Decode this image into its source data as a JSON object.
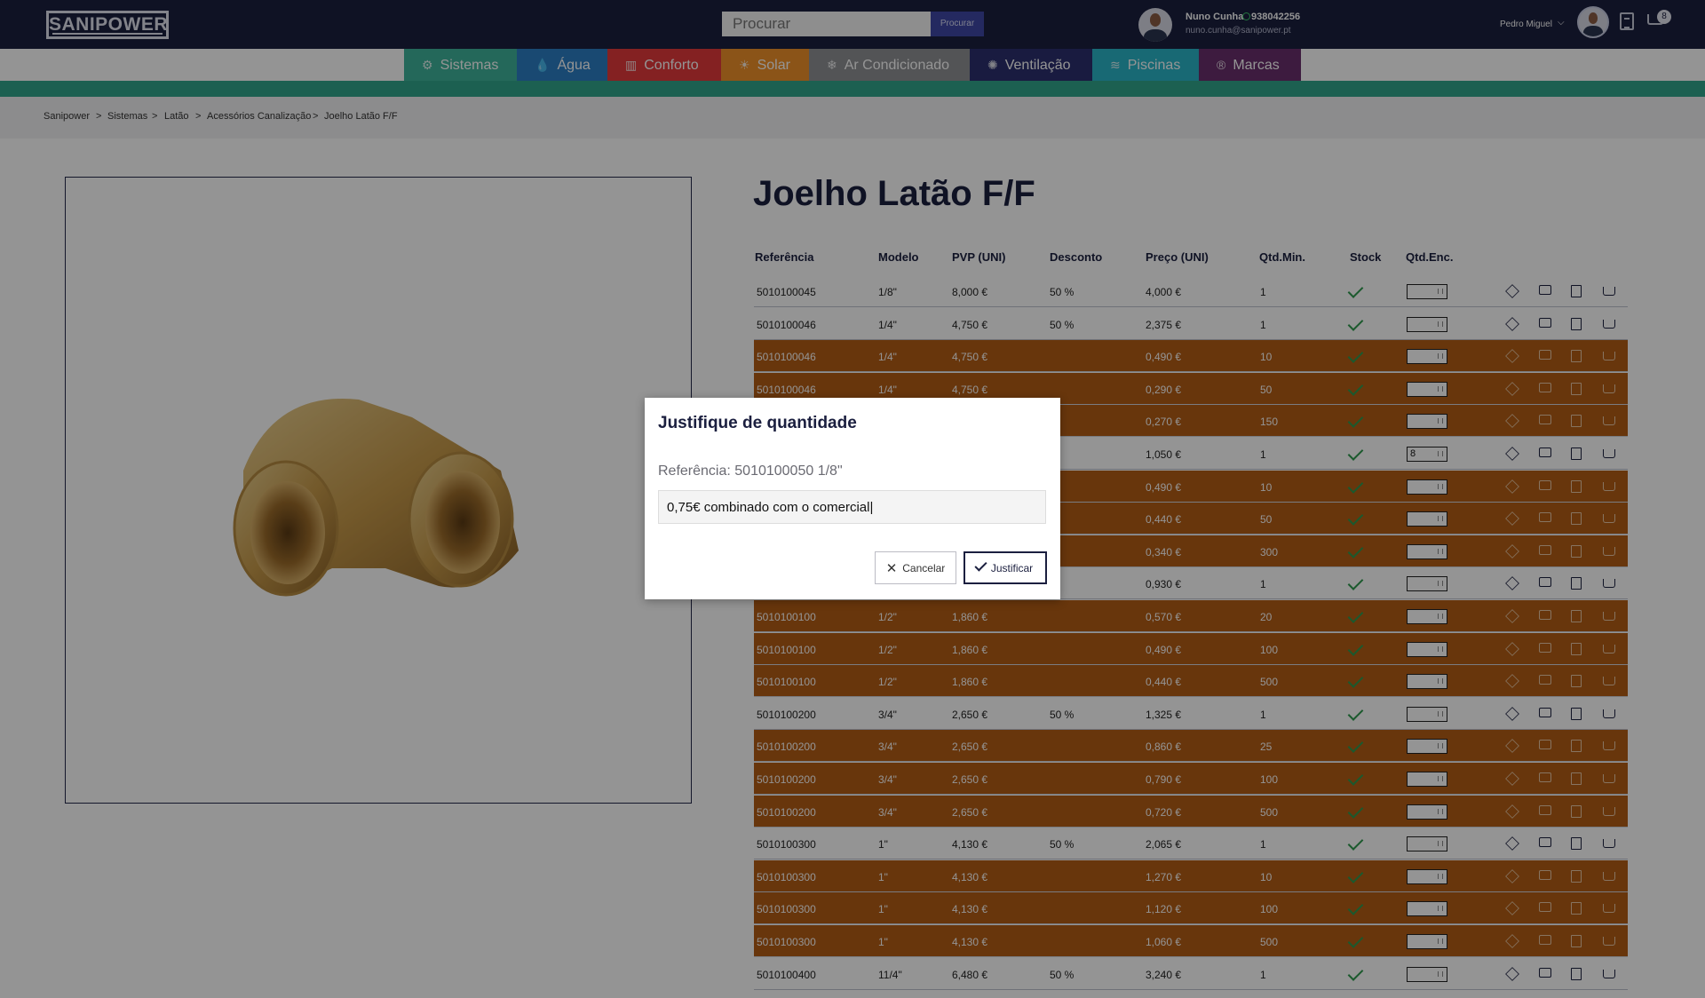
{
  "header": {
    "logo": "SANIPOWER",
    "search_placeholder": "Procurar",
    "search_button": "Procurar",
    "contact_name": "Nuno Cunha",
    "contact_phone": "938042256",
    "contact_email": "nuno.cunha@sanipower.pt",
    "user_name": "Pedro Miguel",
    "cart_count": "8"
  },
  "nav": [
    {
      "label": "Sistemas",
      "color": "#3fb39c",
      "icon": "gear-icon"
    },
    {
      "label": "Água",
      "color": "#2c7fc4",
      "icon": "water-drops-icon"
    },
    {
      "label": "Conforto",
      "color": "#e43a3b",
      "icon": "radiator-icon"
    },
    {
      "label": "Solar",
      "color": "#f0922a",
      "icon": "sun-icon"
    },
    {
      "label": "Ar Condicionado",
      "color": "#8f9195",
      "icon": "ac-unit-icon"
    },
    {
      "label": "Ventilação",
      "color": "#2b2f6e",
      "icon": "fan-icon"
    },
    {
      "label": "Piscinas",
      "color": "#2ab6c8",
      "icon": "pool-icon"
    },
    {
      "label": "Marcas",
      "color": "#6a2f6d",
      "icon": "registered-icon"
    }
  ],
  "breadcrumb": [
    "Sanipower",
    "Sistemas",
    "Latão",
    "Acessórios Canalização",
    "Joelho Latão F/F"
  ],
  "product": {
    "title": "Joelho Latão F/F",
    "image": "brass-elbow-fitting-image"
  },
  "table": {
    "headers": [
      "Referência",
      "Modelo",
      "PVP (UNI)",
      "Desconto",
      "Preço (UNI)",
      "Qtd.Min.",
      "Stock",
      "Qtd.Enc."
    ],
    "rows": [
      {
        "ref": "5010100045",
        "model": "1/8\"",
        "pvp": "8,000 €",
        "disc": "50 %",
        "price": "4,000 €",
        "min": "1",
        "qty": "",
        "highlight": false
      },
      {
        "ref": "5010100046",
        "model": "1/4\"",
        "pvp": "4,750 €",
        "disc": "50 %",
        "price": "2,375 €",
        "min": "1",
        "qty": "",
        "highlight": false
      },
      {
        "ref": "5010100046",
        "model": "1/4\"",
        "pvp": "4,750 €",
        "disc": "",
        "price": "0,490 €",
        "min": "10",
        "qty": "",
        "highlight": true
      },
      {
        "ref": "5010100046",
        "model": "1/4\"",
        "pvp": "4,750 €",
        "disc": "",
        "price": "0,290 €",
        "min": "50",
        "qty": "",
        "highlight": true
      },
      {
        "ref": "",
        "model": "",
        "pvp": "",
        "disc": "",
        "price": "0,270 €",
        "min": "150",
        "qty": "",
        "highlight": true
      },
      {
        "ref": "",
        "model": "",
        "pvp": "",
        "disc": "% ",
        "price": "1,050 €",
        "min": "1",
        "qty": "8",
        "highlight": false
      },
      {
        "ref": "",
        "model": "",
        "pvp": "",
        "disc": "",
        "price": "0,490 €",
        "min": "10",
        "qty": "",
        "highlight": true
      },
      {
        "ref": "",
        "model": "",
        "pvp": "",
        "disc": "",
        "price": "0,440 €",
        "min": "50",
        "qty": "",
        "highlight": true
      },
      {
        "ref": "",
        "model": "",
        "pvp": "",
        "disc": "",
        "price": "0,340 €",
        "min": "300",
        "qty": "",
        "highlight": true
      },
      {
        "ref": "",
        "model": "",
        "pvp": "",
        "disc": "% ",
        "price": "0,930 €",
        "min": "1",
        "qty": "",
        "highlight": false
      },
      {
        "ref": "5010100100",
        "model": "1/2\"",
        "pvp": "1,860 €",
        "disc": "",
        "price": "0,570 €",
        "min": "20",
        "qty": "",
        "highlight": true
      },
      {
        "ref": "5010100100",
        "model": "1/2\"",
        "pvp": "1,860 €",
        "disc": "",
        "price": "0,490 €",
        "min": "100",
        "qty": "",
        "highlight": true
      },
      {
        "ref": "5010100100",
        "model": "1/2\"",
        "pvp": "1,860 €",
        "disc": "",
        "price": "0,440 €",
        "min": "500",
        "qty": "",
        "highlight": true
      },
      {
        "ref": "5010100200",
        "model": "3/4\"",
        "pvp": "2,650 €",
        "disc": "50 %",
        "price": "1,325 €",
        "min": "1",
        "qty": "",
        "highlight": false
      },
      {
        "ref": "5010100200",
        "model": "3/4\"",
        "pvp": "2,650 €",
        "disc": "",
        "price": "0,860 €",
        "min": "25",
        "qty": "",
        "highlight": true
      },
      {
        "ref": "5010100200",
        "model": "3/4\"",
        "pvp": "2,650 €",
        "disc": "",
        "price": "0,790 €",
        "min": "100",
        "qty": "",
        "highlight": true
      },
      {
        "ref": "5010100200",
        "model": "3/4\"",
        "pvp": "2,650 €",
        "disc": "",
        "price": "0,720 €",
        "min": "500",
        "qty": "",
        "highlight": true
      },
      {
        "ref": "5010100300",
        "model": "1\"",
        "pvp": "4,130 €",
        "disc": "50 %",
        "price": "2,065 €",
        "min": "1",
        "qty": "",
        "highlight": false
      },
      {
        "ref": "5010100300",
        "model": "1\"",
        "pvp": "4,130 €",
        "disc": "",
        "price": "1,270 €",
        "min": "10",
        "qty": "",
        "highlight": true
      },
      {
        "ref": "5010100300",
        "model": "1\"",
        "pvp": "4,130 €",
        "disc": "",
        "price": "1,120 €",
        "min": "100",
        "qty": "",
        "highlight": true
      },
      {
        "ref": "5010100300",
        "model": "1\"",
        "pvp": "4,130 €",
        "disc": "",
        "price": "1,060 €",
        "min": "500",
        "qty": "",
        "highlight": true
      },
      {
        "ref": "5010100400",
        "model": "11/4\"",
        "pvp": "6,480 €",
        "disc": "50 %",
        "price": "3,240 €",
        "min": "1",
        "qty": "",
        "highlight": false
      }
    ]
  },
  "modal": {
    "title": "Justifique de quantidade",
    "reference": "Referência: 5010100050 1/8\"",
    "input_value": "0,75€ combinado com o comercial|",
    "cancel_label": "Cancelar",
    "confirm_label": "Justificar"
  }
}
